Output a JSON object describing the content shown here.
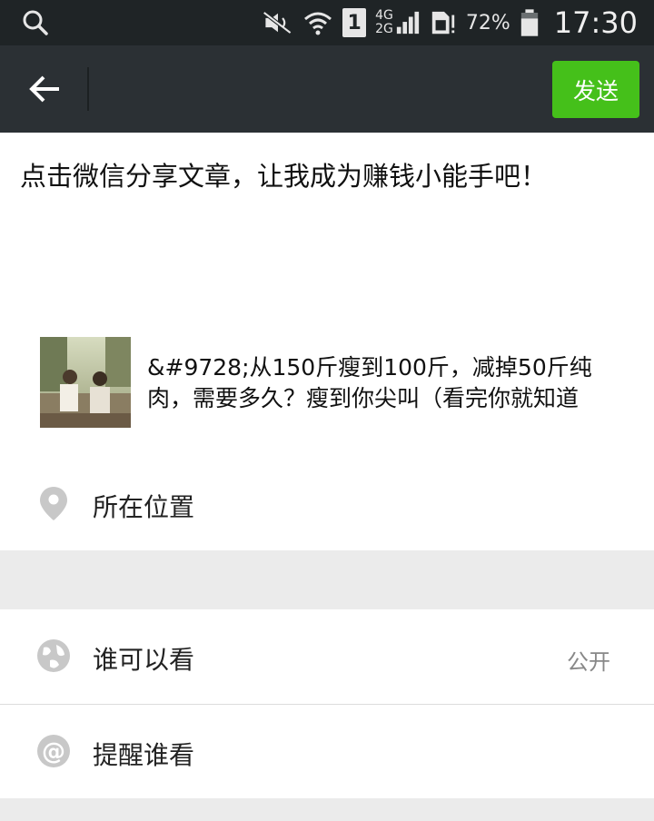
{
  "status_bar": {
    "battery_percent": "72%",
    "time": "17:30",
    "network_labels": [
      "4G",
      "2G"
    ],
    "sim_slot": "1",
    "icons": [
      "search-icon",
      "mute-icon",
      "wifi-icon",
      "sim-icon",
      "signal-icon",
      "sim-alert-icon",
      "battery-icon"
    ]
  },
  "toolbar": {
    "send_label": "发送",
    "back_icon": "arrow-left-icon",
    "accent_color": "#45c01a"
  },
  "post": {
    "text": "点击微信分享文章，让我成为赚钱小能手吧！"
  },
  "article": {
    "title": "&#9728;从150斤瘦到100斤，减掉50斤纯肉，需要多久？瘦到你尖叫（看完你就知道"
  },
  "options": {
    "location": {
      "label": "所在位置",
      "icon": "location-pin-icon"
    },
    "visibility": {
      "label": "谁可以看",
      "value": "公开",
      "icon": "globe-icon"
    },
    "mention": {
      "label": "提醒谁看",
      "icon": "at-icon"
    }
  }
}
